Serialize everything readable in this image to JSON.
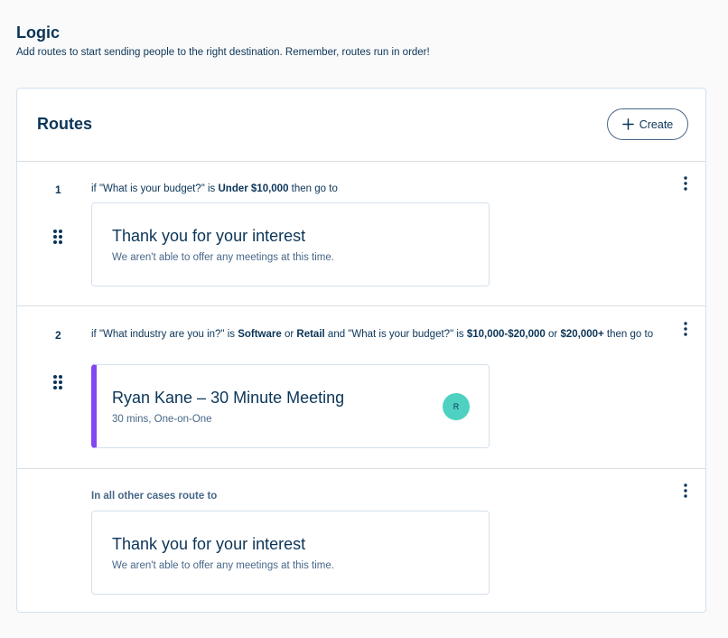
{
  "page": {
    "title": "Logic",
    "subtitle": "Add routes to start sending people to the right destination. Remember, routes run in order!"
  },
  "routes_card": {
    "title": "Routes",
    "create_label": "Create"
  },
  "routes": [
    {
      "number": "1",
      "condition": [
        {
          "text": "if \"What is your budget?\" is ",
          "bold": false
        },
        {
          "text": "Under $10,000",
          "bold": true
        },
        {
          "text": " then go to",
          "bold": false
        }
      ],
      "destination": {
        "title": "Thank you for your interest",
        "subtitle": "We aren't able to offer any meetings at this time."
      }
    },
    {
      "number": "2",
      "condition": [
        {
          "text": "if \"What industry are you in?\" is ",
          "bold": false
        },
        {
          "text": "Software",
          "bold": true
        },
        {
          "text": " or ",
          "bold": false
        },
        {
          "text": "Retail",
          "bold": true
        },
        {
          "text": " and \"What is your budget?\" is ",
          "bold": false
        },
        {
          "text": "$10,000-$20,000",
          "bold": true
        },
        {
          "text": " or ",
          "bold": false
        },
        {
          "text": "$20,000+",
          "bold": true
        },
        {
          "text": " then go to",
          "bold": false
        }
      ],
      "destination": {
        "title": "Ryan Kane – 30 Minute Meeting",
        "subtitle": "30 mins, One-on-One",
        "avatar": "R",
        "accent_color": "#8247f5"
      }
    }
  ],
  "fallback": {
    "label": "In all other cases route to",
    "destination": {
      "title": "Thank you for your interest",
      "subtitle": "We aren't able to offer any meetings at this time."
    }
  },
  "icons": {
    "create": "plus-icon",
    "drag": "drag-handle-icon",
    "more": "more-vertical-icon"
  },
  "colors": {
    "text": "#0b3558",
    "muted": "#476788",
    "accent": "#8247f5",
    "avatar": "#4fd1c1"
  }
}
